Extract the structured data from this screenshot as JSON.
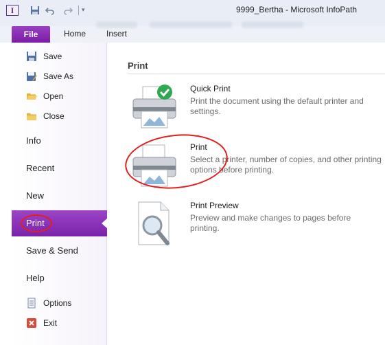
{
  "window": {
    "title": "9999_Bertha - Microsoft InfoPath",
    "app_icon_letter": "I"
  },
  "ribbon": {
    "tabs": [
      {
        "label": "File"
      },
      {
        "label": "Home"
      },
      {
        "label": "Insert"
      }
    ]
  },
  "nav": {
    "items": [
      {
        "label": "Save",
        "icon": "save-icon"
      },
      {
        "label": "Save As",
        "icon": "save-as-icon"
      },
      {
        "label": "Open",
        "icon": "open-folder-icon"
      },
      {
        "label": "Close",
        "icon": "close-folder-icon"
      }
    ],
    "sections": [
      {
        "label": "Info"
      },
      {
        "label": "Recent"
      },
      {
        "label": "New"
      },
      {
        "label": "Print",
        "active": true
      },
      {
        "label": "Save & Send"
      },
      {
        "label": "Help"
      }
    ],
    "footer": [
      {
        "label": "Options",
        "icon": "options-icon"
      },
      {
        "label": "Exit",
        "icon": "exit-icon"
      }
    ]
  },
  "main": {
    "title": "Print",
    "options": [
      {
        "title": "Quick Print",
        "description": "Print the document using the default printer and settings.",
        "icon": "quick-print-icon"
      },
      {
        "title": "Print",
        "description": "Select a printer, number of copies, and other printing options before printing.",
        "icon": "printer-icon"
      },
      {
        "title": "Print Preview",
        "description": "Preview and make changes to pages before printing.",
        "icon": "print-preview-icon"
      }
    ]
  },
  "colors": {
    "accent": "#7b22ab",
    "annotation": "#e02020",
    "check": "#2fa84f"
  }
}
